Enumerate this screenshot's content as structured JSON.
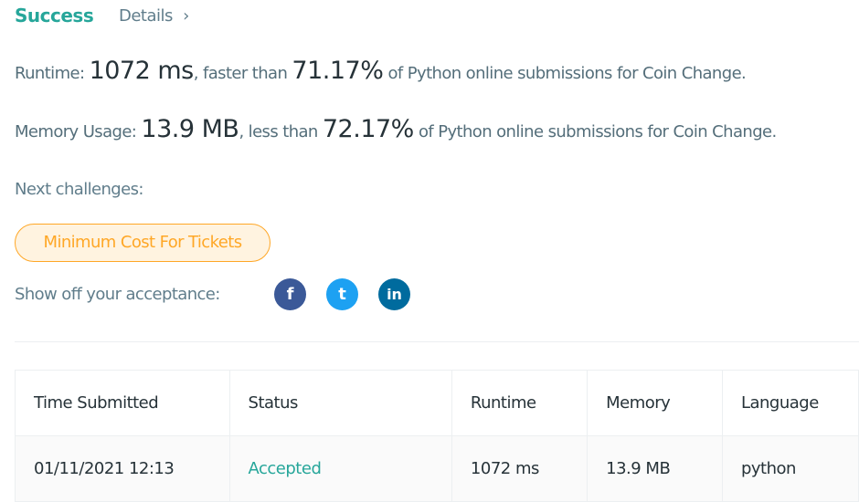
{
  "header": {
    "status": "Success",
    "details": "Details",
    "chevron": "›"
  },
  "runtime": {
    "label": "Runtime:",
    "value": "1072 ms",
    "mid": ", faster than",
    "percent": "71.17%",
    "suffix": "of Python online submissions for Coin Change."
  },
  "memory": {
    "label": "Memory Usage:",
    "value": "13.9 MB",
    "mid": ", less than",
    "percent": "72.17%",
    "suffix": "of Python online submissions for Coin Change."
  },
  "next": {
    "label": "Next challenges:",
    "chip": "Minimum Cost For Tickets"
  },
  "share": {
    "label": "Show off your acceptance:",
    "facebook": "f",
    "twitter": "t",
    "linkedin": "in"
  },
  "table": {
    "headers": [
      "Time Submitted",
      "Status",
      "Runtime",
      "Memory",
      "Language"
    ],
    "rows": [
      {
        "time": "01/11/2021 12:13",
        "status": "Accepted",
        "runtime": "1072 ms",
        "memory": "13.9 MB",
        "language": "python"
      }
    ]
  },
  "colors": {
    "success": "#26a69a",
    "facebook": "#3b5998",
    "twitter": "#1da1f2",
    "linkedin": "#0077b5",
    "chip": "#ffa726"
  }
}
